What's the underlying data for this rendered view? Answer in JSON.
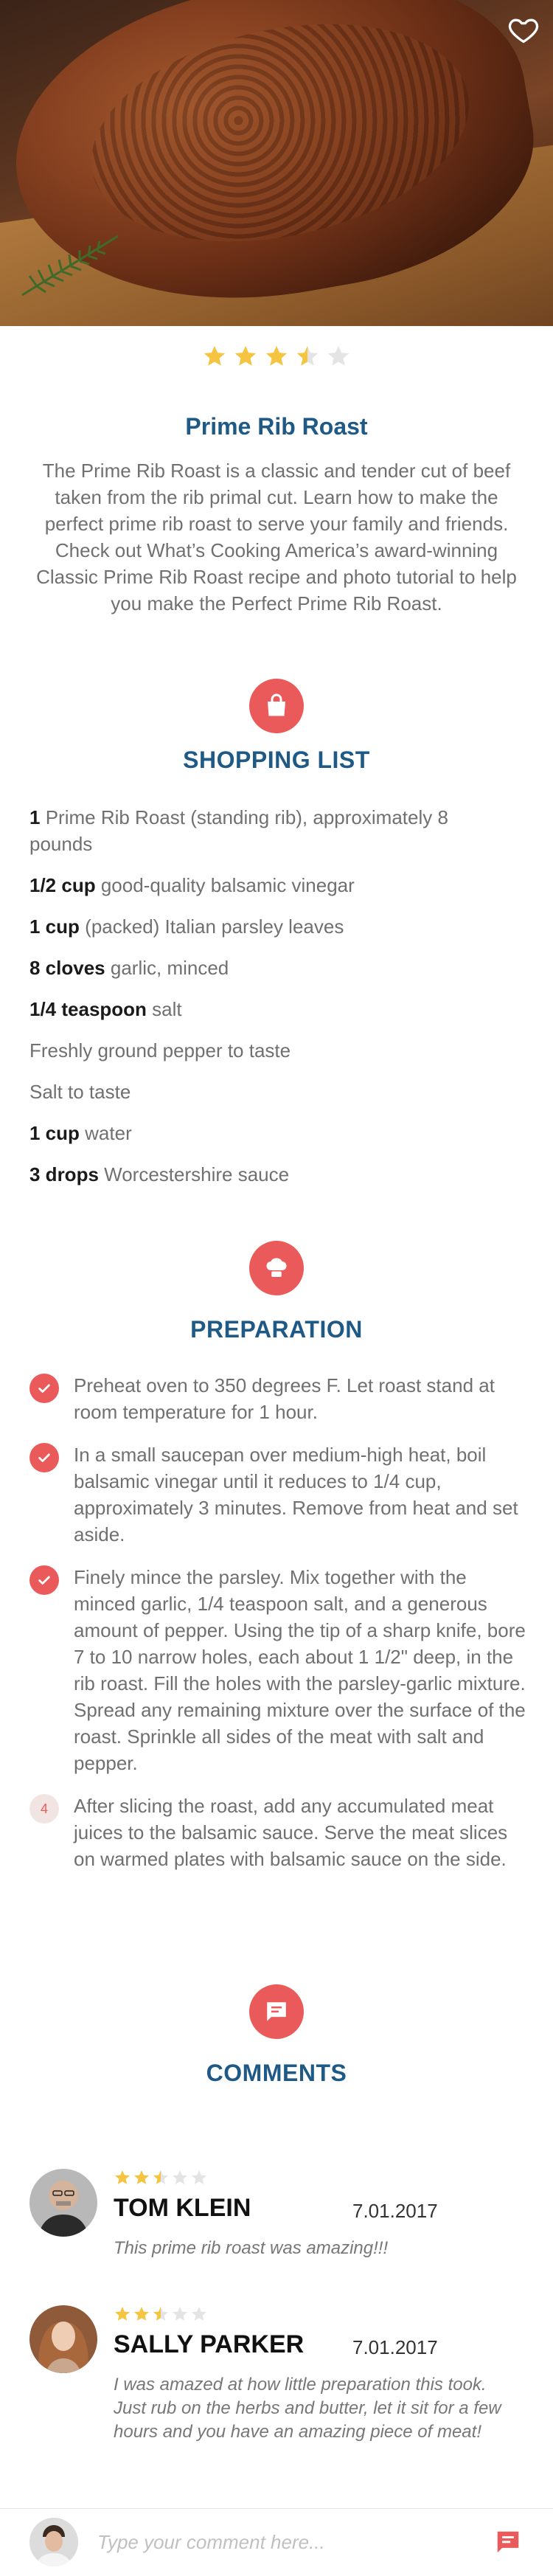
{
  "recipe": {
    "rating": 3.5,
    "title": "Prime Rib Roast",
    "description": "The Prime Rib Roast is a classic and tender cut of beef taken from the rib primal cut.  Learn how to make the perfect prime rib roast to serve your family and friends.  Check out What’s Cooking America’s award-winning Classic Prime Rib Roast recipe and photo tutorial to help you make the Perfect Prime Rib Roast."
  },
  "icons": {
    "favorite": "heart-outline-icon",
    "shopping": "shopping-bag-icon",
    "preparation": "chef-hat-icon",
    "comments": "comment-icon",
    "check": "check-icon",
    "send": "send-message-icon",
    "star": "star-icon"
  },
  "colors": {
    "accent": "#ea5a5a",
    "heading": "#1f5a86",
    "star_filled": "#f5c441",
    "star_empty": "#e4e4e4"
  },
  "shopping_list": {
    "title": "SHOPPING LIST",
    "items": [
      {
        "qty": "1",
        "text": "Prime Rib Roast (standing rib), approximately 8 pounds"
      },
      {
        "qty": "1/2 cup",
        "text": "good-quality balsamic vinegar"
      },
      {
        "qty": "1 cup",
        "text": "(packed) Italian parsley leaves"
      },
      {
        "qty": "8 cloves",
        "text": "garlic, minced"
      },
      {
        "qty": "1/4 teaspoon",
        "text": "salt"
      },
      {
        "qty": "",
        "text": "Freshly ground pepper to taste"
      },
      {
        "qty": "",
        "text": "Salt to taste"
      },
      {
        "qty": "1 cup",
        "text": "water"
      },
      {
        "qty": "3 drops",
        "text": "Worcestershire sauce"
      }
    ]
  },
  "preparation": {
    "title": "PREPARATION",
    "steps": [
      {
        "done": true,
        "number": "1",
        "text": "Preheat oven to 350 degrees F.  Let roast stand at room temperature for 1 hour."
      },
      {
        "done": true,
        "number": "2",
        "text": "In a small saucepan over medium-high heat, boil balsamic vinegar until it reduces to 1/4 cup, approximately 3 minutes.  Remove from heat and set aside."
      },
      {
        "done": true,
        "number": "3",
        "text": "Finely mince the parsley.  Mix together with the minced garlic, 1/4 teaspoon salt, and a generous amount of pepper.  Using the tip of a sharp knife, bore 7 to 10 narrow holes, each about 1 1/2\" deep, in the rib roast.  Fill the holes with the parsley-garlic mixture.  Spread any remaining mixture over the surface of the roast.  Sprinkle all sides of the meat with salt and pepper."
      },
      {
        "done": false,
        "number": "4",
        "text": "After slicing the roast, add any accumulated meat juices to the balsamic sauce.  Serve the meat slices on warmed plates with balsamic sauce on the side."
      }
    ]
  },
  "comments": {
    "title": "COMMENTS",
    "items": [
      {
        "author": "TOM KLEIN",
        "date": "7.01.2017",
        "rating": 2.5,
        "text": "This prime rib roast was amazing!!!"
      },
      {
        "author": "SALLY PARKER",
        "date": "7.01.2017",
        "rating": 2.5,
        "text": "I was amazed at how little preparation this took.  Just rub on the herbs and butter, let it sit for a few hours and you have an amazing piece of meat!"
      }
    ]
  },
  "composer": {
    "placeholder": "Type your comment here..."
  }
}
